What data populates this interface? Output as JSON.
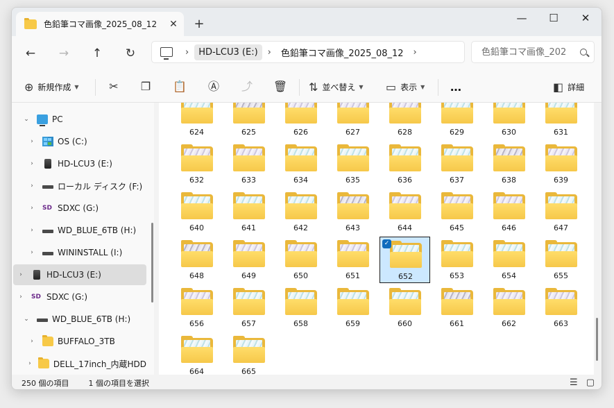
{
  "tab": {
    "title": "色鉛筆コマ画像_2025_08_12",
    "close": "✕",
    "new": "+"
  },
  "window_controls": {
    "minimize": "—",
    "maximize": "☐",
    "close": "✕"
  },
  "nav": {
    "back": "←",
    "forward": "→",
    "up": "↑",
    "refresh": "↻"
  },
  "address": {
    "sep": "›",
    "crumbs": [
      "HD-LCU3 (E:)",
      "色鉛筆コマ画像_2025_08_12"
    ]
  },
  "search": {
    "placeholder": "色鉛筆コマ画像_202"
  },
  "toolbar": {
    "new_label": "新規作成",
    "sort_label": "並べ替え",
    "view_label": "表示",
    "more": "…",
    "details_label": "詳細"
  },
  "sidebar": {
    "items": [
      {
        "label": "PC",
        "arrow": "⌄",
        "icon": "pc-icon"
      },
      {
        "label": "OS (C:)",
        "arrow": "›",
        "icon": "windows-drive-icon"
      },
      {
        "label": "HD-LCU3 (E:)",
        "arrow": "›",
        "icon": "external-hdd-icon"
      },
      {
        "label": "ローカル ディスク (F:)",
        "arrow": "›",
        "icon": "drive-icon"
      },
      {
        "label": "SDXC (G:)",
        "arrow": "›",
        "icon": "sd-card-icon"
      },
      {
        "label": "WD_BLUE_6TB (H:)",
        "arrow": "›",
        "icon": "drive-icon"
      },
      {
        "label": "WININSTALL (I:)",
        "arrow": "›",
        "icon": "drive-icon"
      },
      {
        "label": "HD-LCU3 (E:)",
        "arrow": "›",
        "icon": "external-hdd-icon"
      },
      {
        "label": "SDXC (G:)",
        "arrow": "›",
        "icon": "sd-card-icon"
      },
      {
        "label": "WD_BLUE_6TB (H:)",
        "arrow": "⌄",
        "icon": "drive-icon"
      },
      {
        "label": "BUFFALO_3TB",
        "arrow": "›",
        "icon": "folder-icon"
      },
      {
        "label": "DELL_17inch_内蔵HDD",
        "arrow": "›",
        "icon": "folder-icon"
      }
    ]
  },
  "folders": [
    "624",
    "625",
    "626",
    "627",
    "628",
    "629",
    "630",
    "631",
    "632",
    "633",
    "634",
    "635",
    "636",
    "637",
    "638",
    "639",
    "640",
    "641",
    "642",
    "643",
    "644",
    "645",
    "646",
    "647",
    "648",
    "649",
    "650",
    "651",
    "652",
    "653",
    "654",
    "655",
    "656",
    "657",
    "658",
    "659",
    "660",
    "661",
    "662",
    "663",
    "664",
    "665"
  ],
  "selected_folder": "652",
  "status": {
    "count": "250 個の項目",
    "selected": "1 個の項目を選択"
  }
}
